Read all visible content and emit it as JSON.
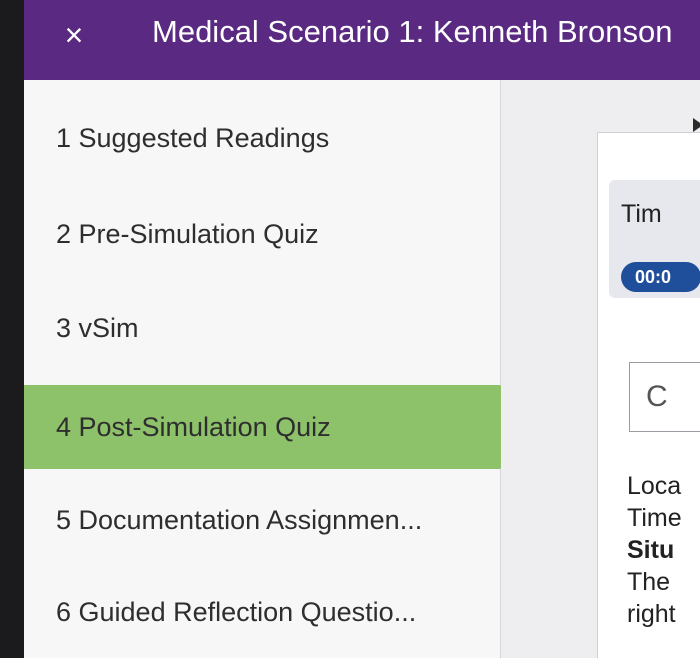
{
  "header": {
    "close_label": "×",
    "title": "Medical Scenario 1: Kenneth Bronson"
  },
  "sidebar": {
    "items": [
      {
        "label": "1 Suggested Readings",
        "active": false
      },
      {
        "label": "2 Pre-Simulation Quiz",
        "active": false
      },
      {
        "label": "3 vSim",
        "active": false
      },
      {
        "label": "4 Post-Simulation Quiz",
        "active": true
      },
      {
        "label": "5 Documentation Assignmen...",
        "active": false
      },
      {
        "label": "6 Guided Reflection Questio...",
        "active": false
      }
    ]
  },
  "main": {
    "timer_label": "Tim",
    "timer_value": "00:0",
    "button_label": "C",
    "info_lines": [
      "Loca",
      "Time",
      "Situ",
      "The",
      "right"
    ]
  },
  "colors": {
    "header": "#5a2a82",
    "active_item": "#8dc26b",
    "timer_pill": "#1f4e9b"
  }
}
